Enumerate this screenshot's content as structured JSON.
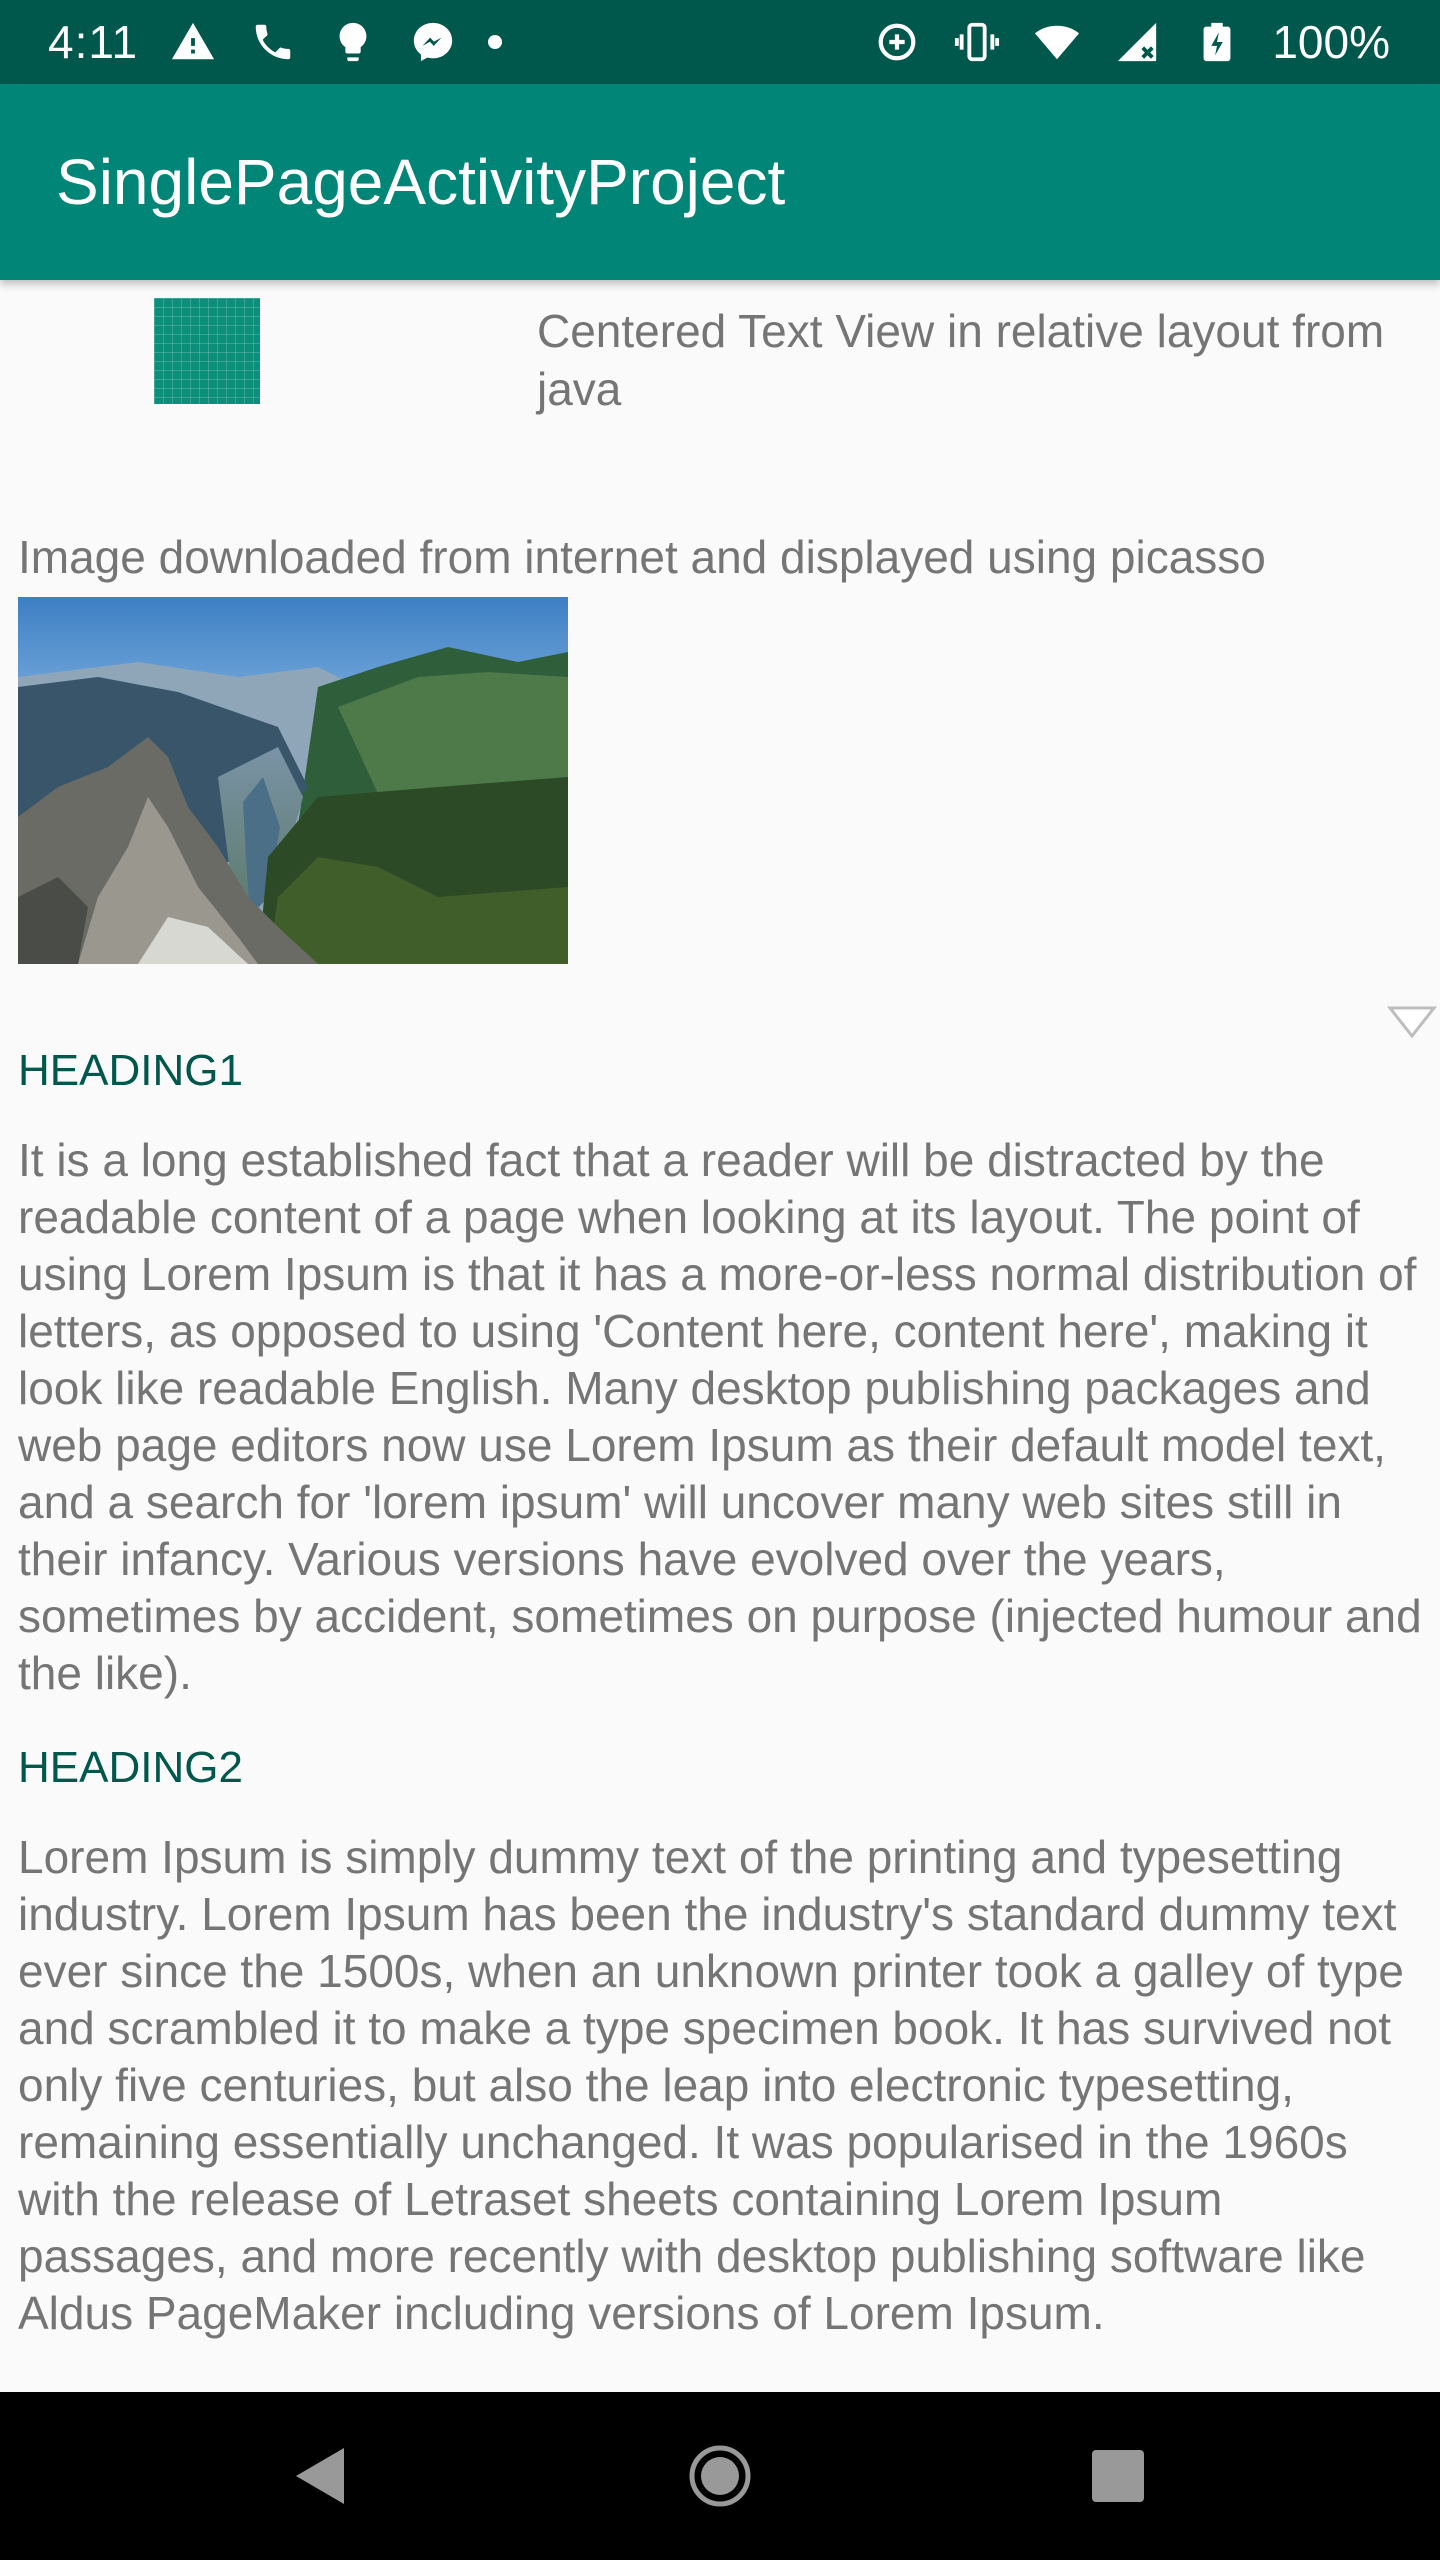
{
  "status_bar": {
    "time": "4:11",
    "battery_percent": "100%",
    "left_icons": [
      "warning-icon",
      "phone-icon",
      "bulb-icon",
      "messenger-icon",
      "dot-icon"
    ],
    "right_icons": [
      "data-saver-icon",
      "vibrate-icon",
      "wifi-icon",
      "signal-icon",
      "battery-icon"
    ]
  },
  "app_bar": {
    "title": "SinglePageActivityProject"
  },
  "content": {
    "centered_text": "Centered Text View in relative layout from java",
    "image_label": "Image downloaded from internet and displayed using picasso",
    "heading1": "HEADING1",
    "paragraph1": "It is a long established fact that a reader will be distracted by the readable content of a page when looking at its layout. The point of using Lorem Ipsum is that it has a more-or-less normal distribution of letters, as opposed to using 'Content here, content here', making it look like readable English. Many desktop publishing packages and web page editors now use Lorem Ipsum as their default model text, and a search for 'lorem ipsum' will uncover many web sites still in their infancy. Various versions have evolved over the years, sometimes by accident, sometimes on purpose (injected humour and the like).",
    "heading2": "HEADING2",
    "paragraph2": "Lorem Ipsum is simply dummy text of the printing and typesetting industry. Lorem Ipsum has been the industry's standard dummy text ever since the 1500s, when an unknown printer took a galley of type and scrambled it to make a type specimen book. It has survived not only five centuries, but also the leap into electronic typesetting, remaining essentially unchanged. It was popularised in the 1960s with the release of Letraset sheets containing Lorem Ipsum passages, and more recently with desktop publishing software like Aldus PageMaker including versions of Lorem Ipsum."
  },
  "colors": {
    "status_bar": "#00574b",
    "app_bar": "#008577",
    "heading": "#00574b",
    "body_text": "#757575",
    "background": "#fafafa"
  }
}
